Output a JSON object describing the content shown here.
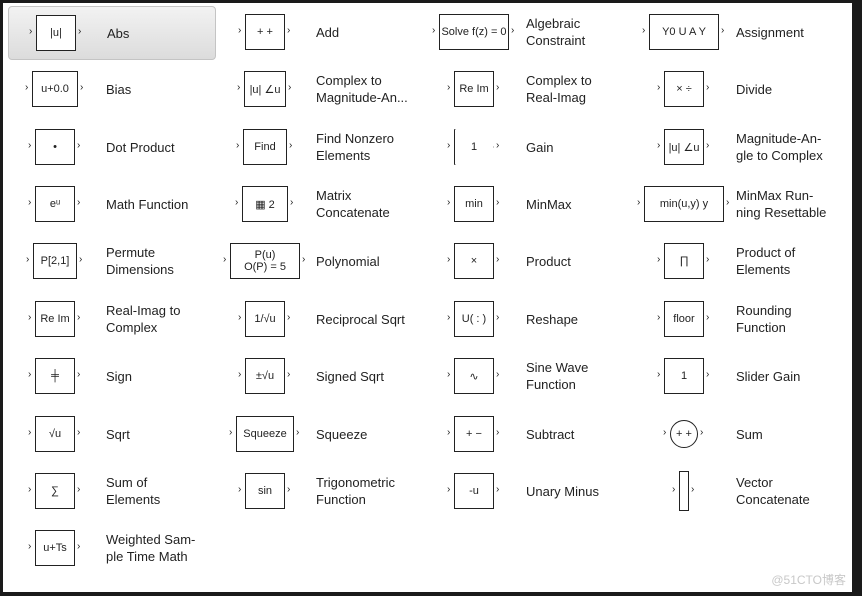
{
  "library": {
    "items": [
      {
        "label": "Abs",
        "icon": "|u|",
        "selected": true
      },
      {
        "label": "Add",
        "icon": "+ +"
      },
      {
        "label": "Algebraic\nConstraint",
        "icon": "Solve f(z) = 0"
      },
      {
        "label": "Assignment",
        "icon": "Y0 U  A  Y"
      },
      {
        "label": "Bias",
        "icon": "u+0.0"
      },
      {
        "label": "Complex to\nMagnitude-An...",
        "icon": "|u| ∠u"
      },
      {
        "label": "Complex to\nReal-Imag",
        "icon": "Re Im"
      },
      {
        "label": "Divide",
        "icon": "× ÷"
      },
      {
        "label": "Dot Product",
        "icon": "•"
      },
      {
        "label": "Find Nonzero\nElements",
        "icon": "Find"
      },
      {
        "label": "Gain",
        "icon": "1"
      },
      {
        "label": "Magnitude-An-\ngle to Complex",
        "icon": "|u| ∠u"
      },
      {
        "label": "Math Function",
        "icon": "eᵘ"
      },
      {
        "label": "Matrix\nConcatenate",
        "icon": "▦ 2"
      },
      {
        "label": "MinMax",
        "icon": "min"
      },
      {
        "label": "MinMax Run-\nning Resettable",
        "icon": "min(u,y)  y"
      },
      {
        "label": "Permute\nDimensions",
        "icon": "P[2,1]"
      },
      {
        "label": "Polynomial",
        "icon": "P(u)\nO(P) = 5"
      },
      {
        "label": "Product",
        "icon": "×"
      },
      {
        "label": "Product of\nElements",
        "icon": "∏"
      },
      {
        "label": "Real-Imag to\nComplex",
        "icon": "Re Im"
      },
      {
        "label": "Reciprocal Sqrt",
        "icon": "1/√u"
      },
      {
        "label": "Reshape",
        "icon": "U( : )"
      },
      {
        "label": "Rounding\nFunction",
        "icon": "floor"
      },
      {
        "label": "Sign",
        "icon": "╪"
      },
      {
        "label": "Signed Sqrt",
        "icon": "±√u"
      },
      {
        "label": "Sine Wave\nFunction",
        "icon": "∿"
      },
      {
        "label": "Slider Gain",
        "icon": "1"
      },
      {
        "label": "Sqrt",
        "icon": "√u"
      },
      {
        "label": "Squeeze",
        "icon": "Squeeze"
      },
      {
        "label": "Subtract",
        "icon": "+ −"
      },
      {
        "label": "Sum",
        "icon": "+ +"
      },
      {
        "label": "Sum of\nElements",
        "icon": "∑"
      },
      {
        "label": "Trigonometric\nFunction",
        "icon": "sin"
      },
      {
        "label": "Unary Minus",
        "icon": "-u"
      },
      {
        "label": "Vector\nConcatenate",
        "icon": ""
      },
      {
        "label": "Weighted Sam-\nple Time Math",
        "icon": "u+Ts"
      }
    ]
  },
  "watermark": "@51CTO博客"
}
